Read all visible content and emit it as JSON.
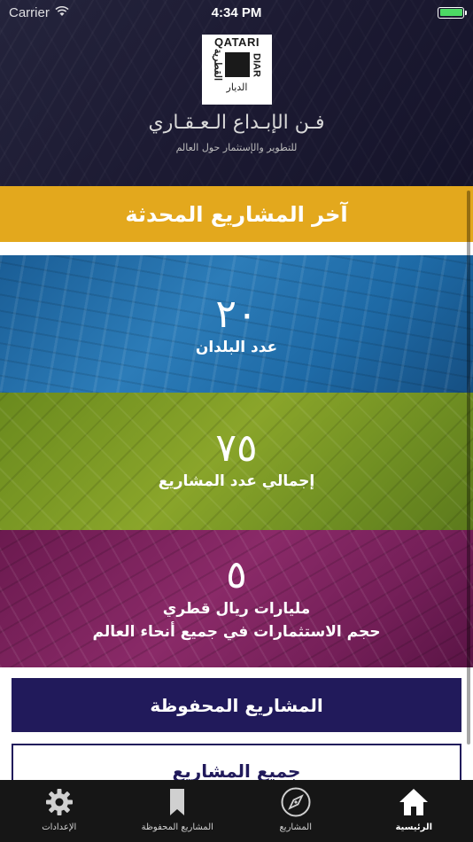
{
  "status_bar": {
    "carrier": "Carrier",
    "time": "4:34 PM",
    "battery_color": "#4cd964"
  },
  "header": {
    "logo": {
      "top_word": "QATARI",
      "side_word": "DIAR",
      "arabic_bottom": "الديار",
      "arabic_side": "القطرية"
    },
    "tagline_main": "فـن الإبـداع الـعـقـاري",
    "tagline_sub": "للتطوير والإستثمار حول العالم"
  },
  "latest_projects": {
    "label": "آخر المشاريع المحدثة",
    "color": "#e3a81d"
  },
  "stats": {
    "countries": {
      "value": "٢٠",
      "label": "عدد البلدان",
      "color": "#2c7cb8"
    },
    "projects": {
      "value": "٧٥",
      "label": "إجمالي عدد المشاريع",
      "color": "#8aa52a"
    },
    "investment": {
      "value": "٥",
      "label_line1": "مليارات ريال قطري",
      "label_line2": "حجم الاستثمارات في جميع أنحاء العالم",
      "color": "#8a2a68"
    }
  },
  "buttons": {
    "saved_projects": "المشاريع المحفوظة",
    "all_projects": "جميع المشاريع",
    "primary_color": "#211a5b"
  },
  "tab_bar": {
    "tabs": [
      {
        "label": "الإعدادات",
        "icon": "gear-icon"
      },
      {
        "label": "المشاريع المحفوظة",
        "icon": "bookmark-icon"
      },
      {
        "label": "المشاريع",
        "icon": "compass-icon"
      },
      {
        "label": "الرئيسية",
        "icon": "home-icon",
        "active": true
      }
    ]
  }
}
